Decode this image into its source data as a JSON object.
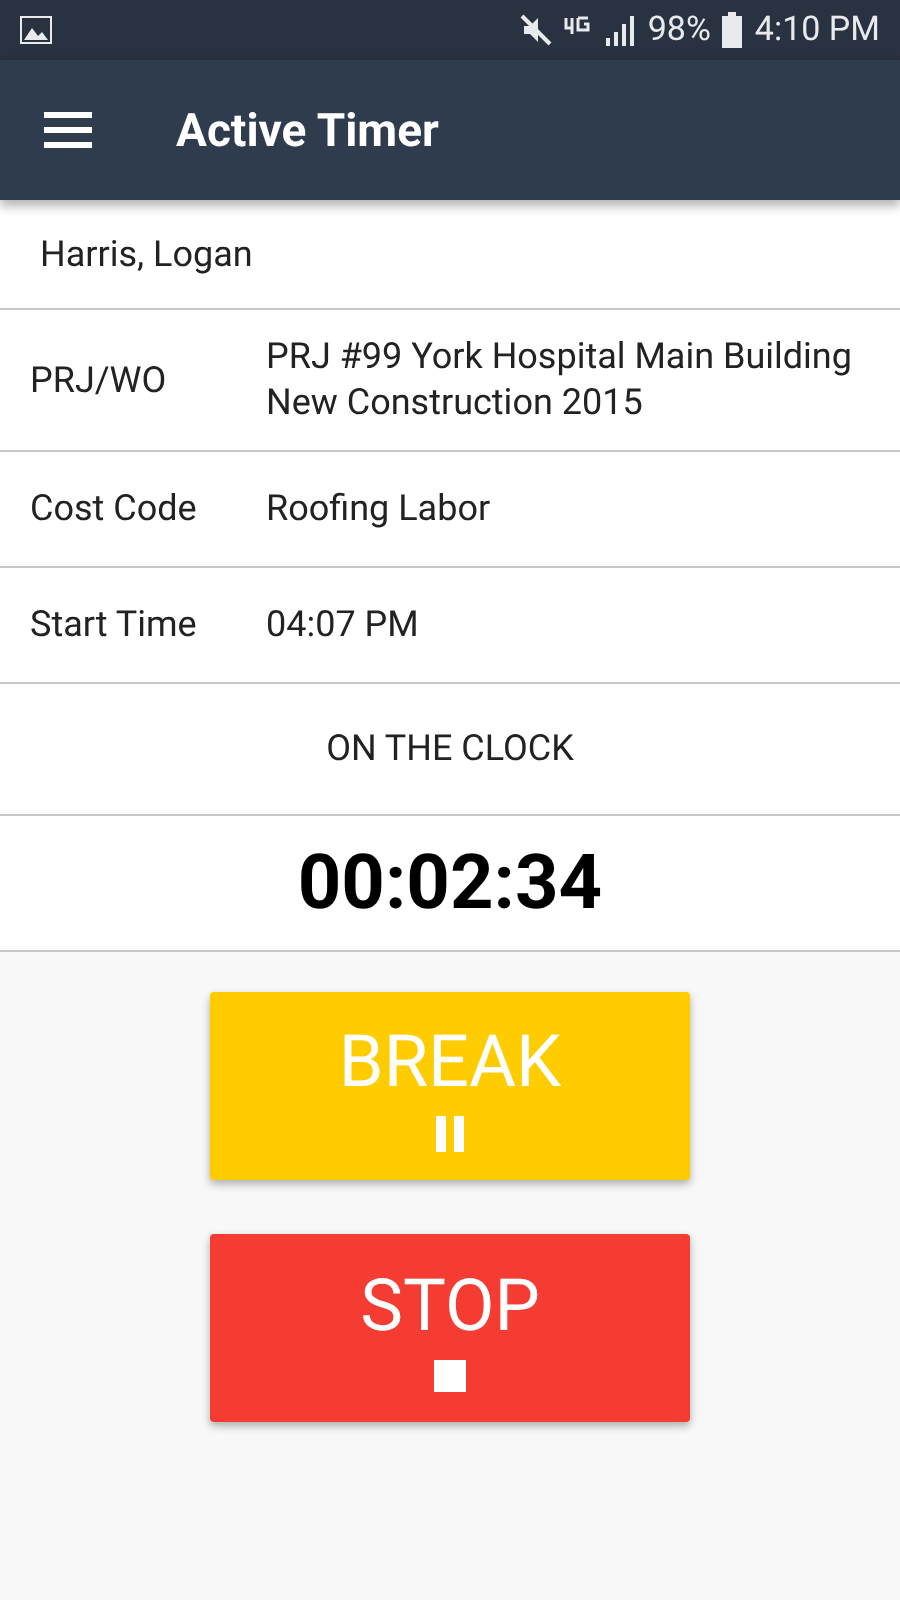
{
  "status_bar": {
    "battery": "98%",
    "time": "4:10 PM"
  },
  "app_bar": {
    "title": "Active Timer"
  },
  "employee": "Harris, Logan",
  "fields": [
    {
      "label": "PRJ/WO",
      "value": "PRJ #99 York Hospital Main Building New Construction 2015"
    },
    {
      "label": "Cost Code",
      "value": "Roofing Labor"
    },
    {
      "label": "Start Time",
      "value": "04:07 PM"
    }
  ],
  "status": "ON THE CLOCK",
  "elapsed": "00:02:34",
  "buttons": [
    {
      "label": "BREAK",
      "kind": "pause",
      "color": "#ffcc00"
    },
    {
      "label": "STOP",
      "kind": "stop",
      "color": "#f43c33"
    }
  ]
}
